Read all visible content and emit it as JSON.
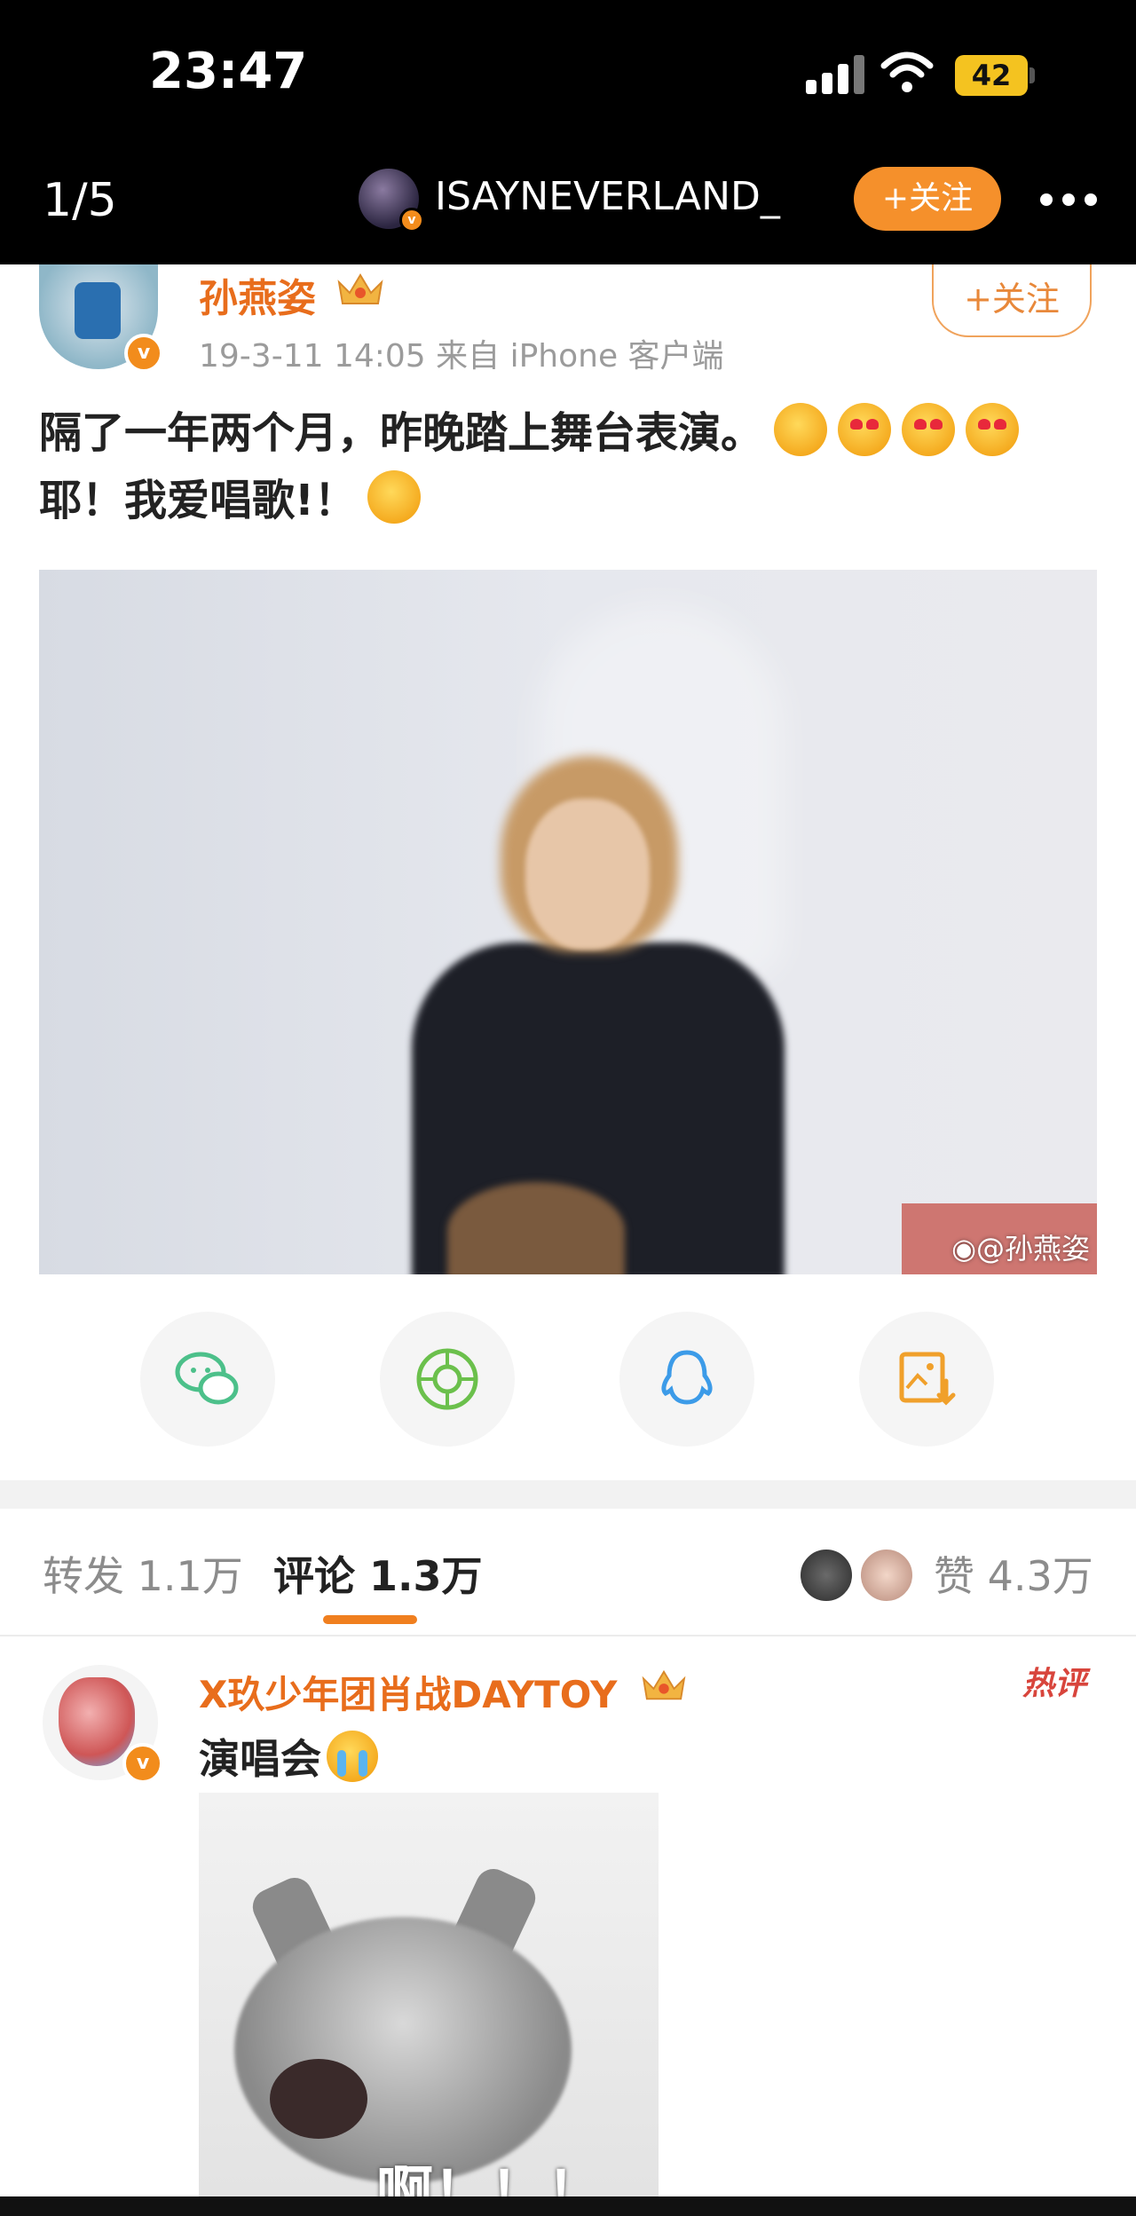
{
  "status_bar": {
    "time": "23:47",
    "battery": "42"
  },
  "header": {
    "page_indicator": "1/5",
    "username": "ISAYNEVERLAND_",
    "follow_label": "+关注"
  },
  "post": {
    "author": "孙燕姿",
    "meta": "19-3-11 14:05  来自 iPhone 客户端",
    "follow_label": "+关注",
    "text_line1": "隔了一年两个月，昨晚踏上舞台表演。",
    "text_line2": "耶！我爱唱歌!！",
    "image_watermark": "@孙燕姿"
  },
  "share": [
    {
      "icon": "wechat-icon",
      "color": "#4cc08a"
    },
    {
      "icon": "moments-icon",
      "color": "#6bc04c"
    },
    {
      "icon": "qq-icon",
      "color": "#3c9be8"
    },
    {
      "icon": "save-image-icon",
      "color": "#f0a02b"
    }
  ],
  "tabs": {
    "repost": "转发 1.1万",
    "comments": "评论 1.3万",
    "likes": "赞 4.3万"
  },
  "comment": {
    "author": "X玖少年团肖战DAYTOY",
    "badge": "热评",
    "text": "演唱会",
    "image_caption": "啊！！！"
  },
  "colors": {
    "accent": "#f5902b",
    "name_orange": "#e86d1c",
    "hot_red": "#d8453c"
  }
}
